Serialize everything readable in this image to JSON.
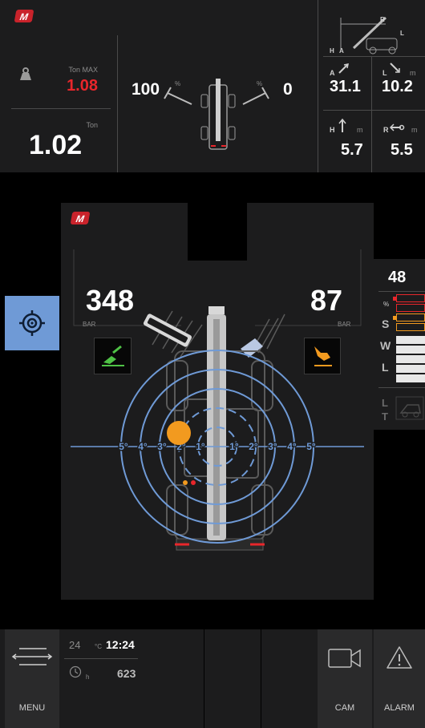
{
  "brand": {
    "logo_text": "M",
    "color": "#c9232b"
  },
  "load": {
    "max_label": "Ton MAX",
    "max_value": "1.08",
    "max_color": "#e8262b",
    "unit_label": "Ton",
    "value": "1.02"
  },
  "tilt": {
    "left_value": "100",
    "left_unit": "%",
    "right_value": "0",
    "right_unit": "%"
  },
  "geometry": {
    "diagram_labels": {
      "r": "R",
      "h": "H",
      "a": "A",
      "l": "L"
    },
    "angle": {
      "label": "A",
      "value": "31.1"
    },
    "length": {
      "label": "L",
      "unit": "m",
      "value": "10.2"
    },
    "height": {
      "label": "H",
      "unit": "m",
      "value": "5.7"
    },
    "reach": {
      "label": "R",
      "unit": "m",
      "value": "5.5"
    }
  },
  "hydraulic": {
    "left_value": "348",
    "left_unit": "BAR",
    "right_value": "87",
    "right_unit": "BAR"
  },
  "level_rings": {
    "left": [
      "5°",
      "4°",
      "3°",
      "2°",
      "1°"
    ],
    "right": [
      "1°",
      "2°",
      "3°",
      "4°",
      "5°"
    ]
  },
  "load_gauge": {
    "value": "48",
    "percent_label": "%",
    "letters": [
      "S",
      "W",
      "L"
    ],
    "limit_letters": [
      "L",
      "T"
    ],
    "colors": {
      "red": "#e8262b",
      "orange": "#f29a1f",
      "white": "#e8e8e8"
    }
  },
  "bottom_bar": {
    "menu_label": "MENU",
    "temp_value": "24",
    "temp_unit": "°C",
    "time": "12:24",
    "hours_unit": "h",
    "hours_value": "623",
    "cam_label": "CAM",
    "alarm_label": "ALARM"
  },
  "colors": {
    "accent_blue": "#6f9ad6",
    "bubble_orange": "#f29a1f",
    "tool_green": "#4fc246"
  }
}
